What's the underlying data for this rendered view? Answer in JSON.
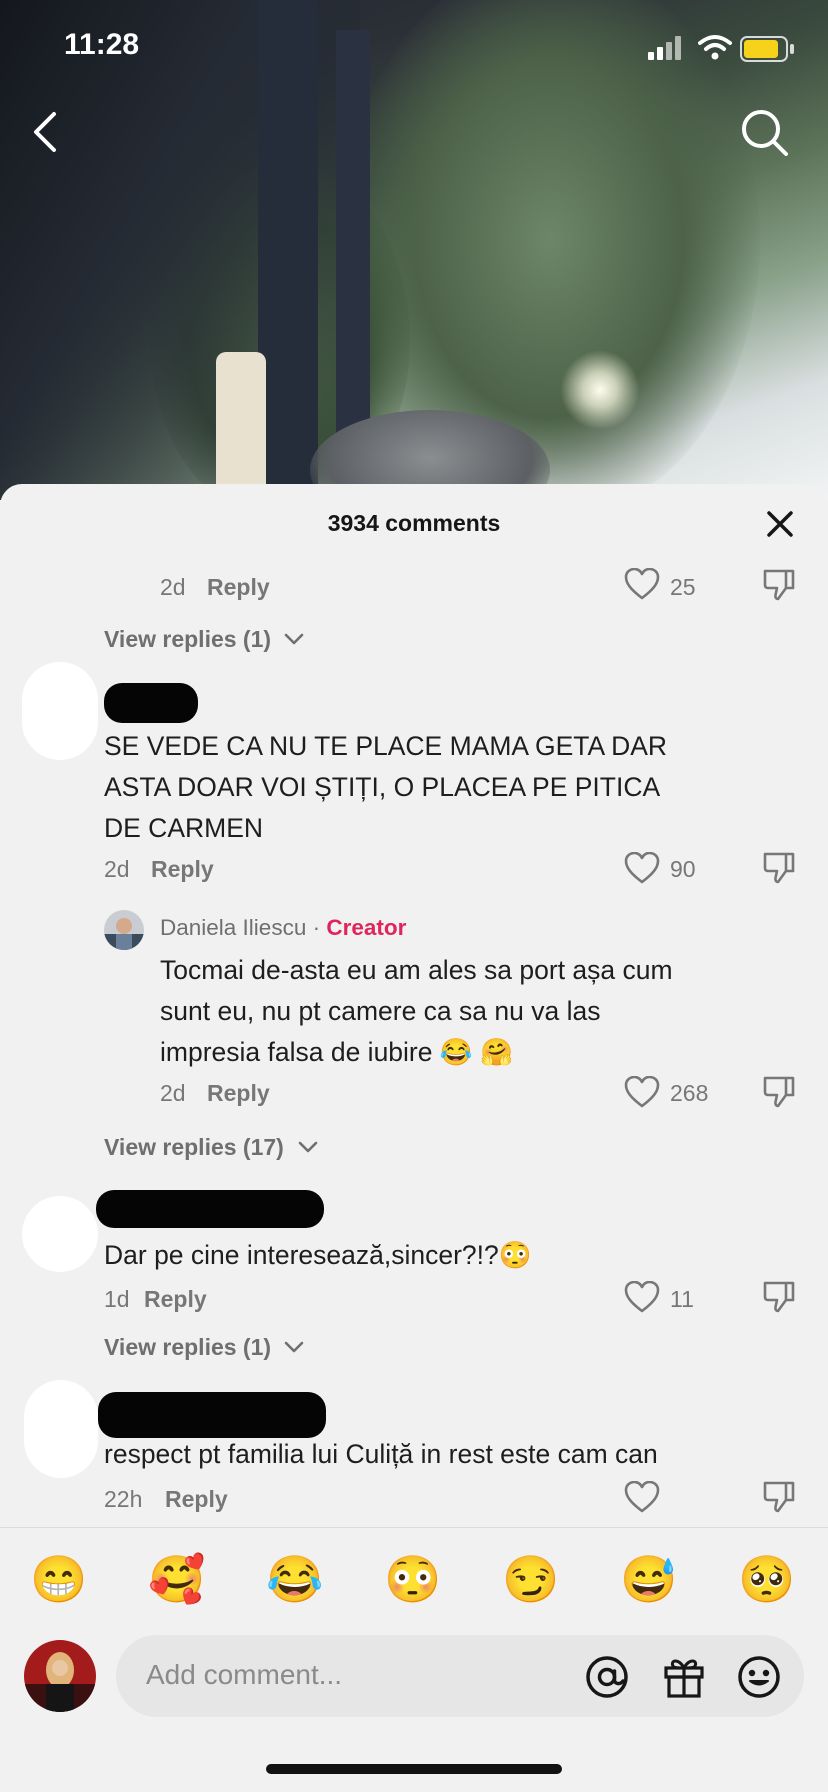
{
  "status_bar": {
    "time": "11:28"
  },
  "sheet": {
    "title": "3934 comments"
  },
  "comments": [
    {
      "time": "2d",
      "reply": "Reply",
      "likes": "25",
      "view_replies": "View replies (1)"
    },
    {
      "text_lines": [
        "SE VEDE CA NU TE PLACE MAMA GETA DAR",
        "ASTA DOAR VOI ȘTIȚI, O PLACEA PE PITICA",
        "DE CARMEN"
      ],
      "time": "2d",
      "reply": "Reply",
      "likes": "90"
    },
    {
      "author": "Daniela Iliescu",
      "dot": "·",
      "badge": "Creator",
      "text_lines": [
        "Tocmai de-asta eu am ales sa port așa cum",
        "sunt eu, nu pt camere ca sa nu va las",
        "impresia falsa de iubire 😂 🤗"
      ],
      "time": "2d",
      "reply": "Reply",
      "likes": "268",
      "view_replies": "View replies (17)"
    },
    {
      "text": "Dar pe cine interesează,sincer?!?😳",
      "time": "1d",
      "reply": "Reply",
      "likes": "11",
      "view_replies": "View replies (1)"
    },
    {
      "text": "respect pt familia lui Culiță in rest este cam can",
      "time": "22h",
      "reply": "Reply"
    }
  ],
  "emoji_bar": [
    "😁",
    "🥰",
    "😂",
    "😳",
    "😏",
    "😅",
    "🥺"
  ],
  "composer": {
    "placeholder": "Add comment..."
  },
  "colors": {
    "creator_badge": "#e0245e",
    "background": "#f1f1f1"
  },
  "icons": [
    "back-arrow-icon",
    "search-icon",
    "close-icon",
    "heart-icon",
    "dislike-icon",
    "chevron-down-icon",
    "at-icon",
    "gift-icon",
    "emoji-icon",
    "signal-icon",
    "wifi-icon",
    "battery-icon"
  ]
}
